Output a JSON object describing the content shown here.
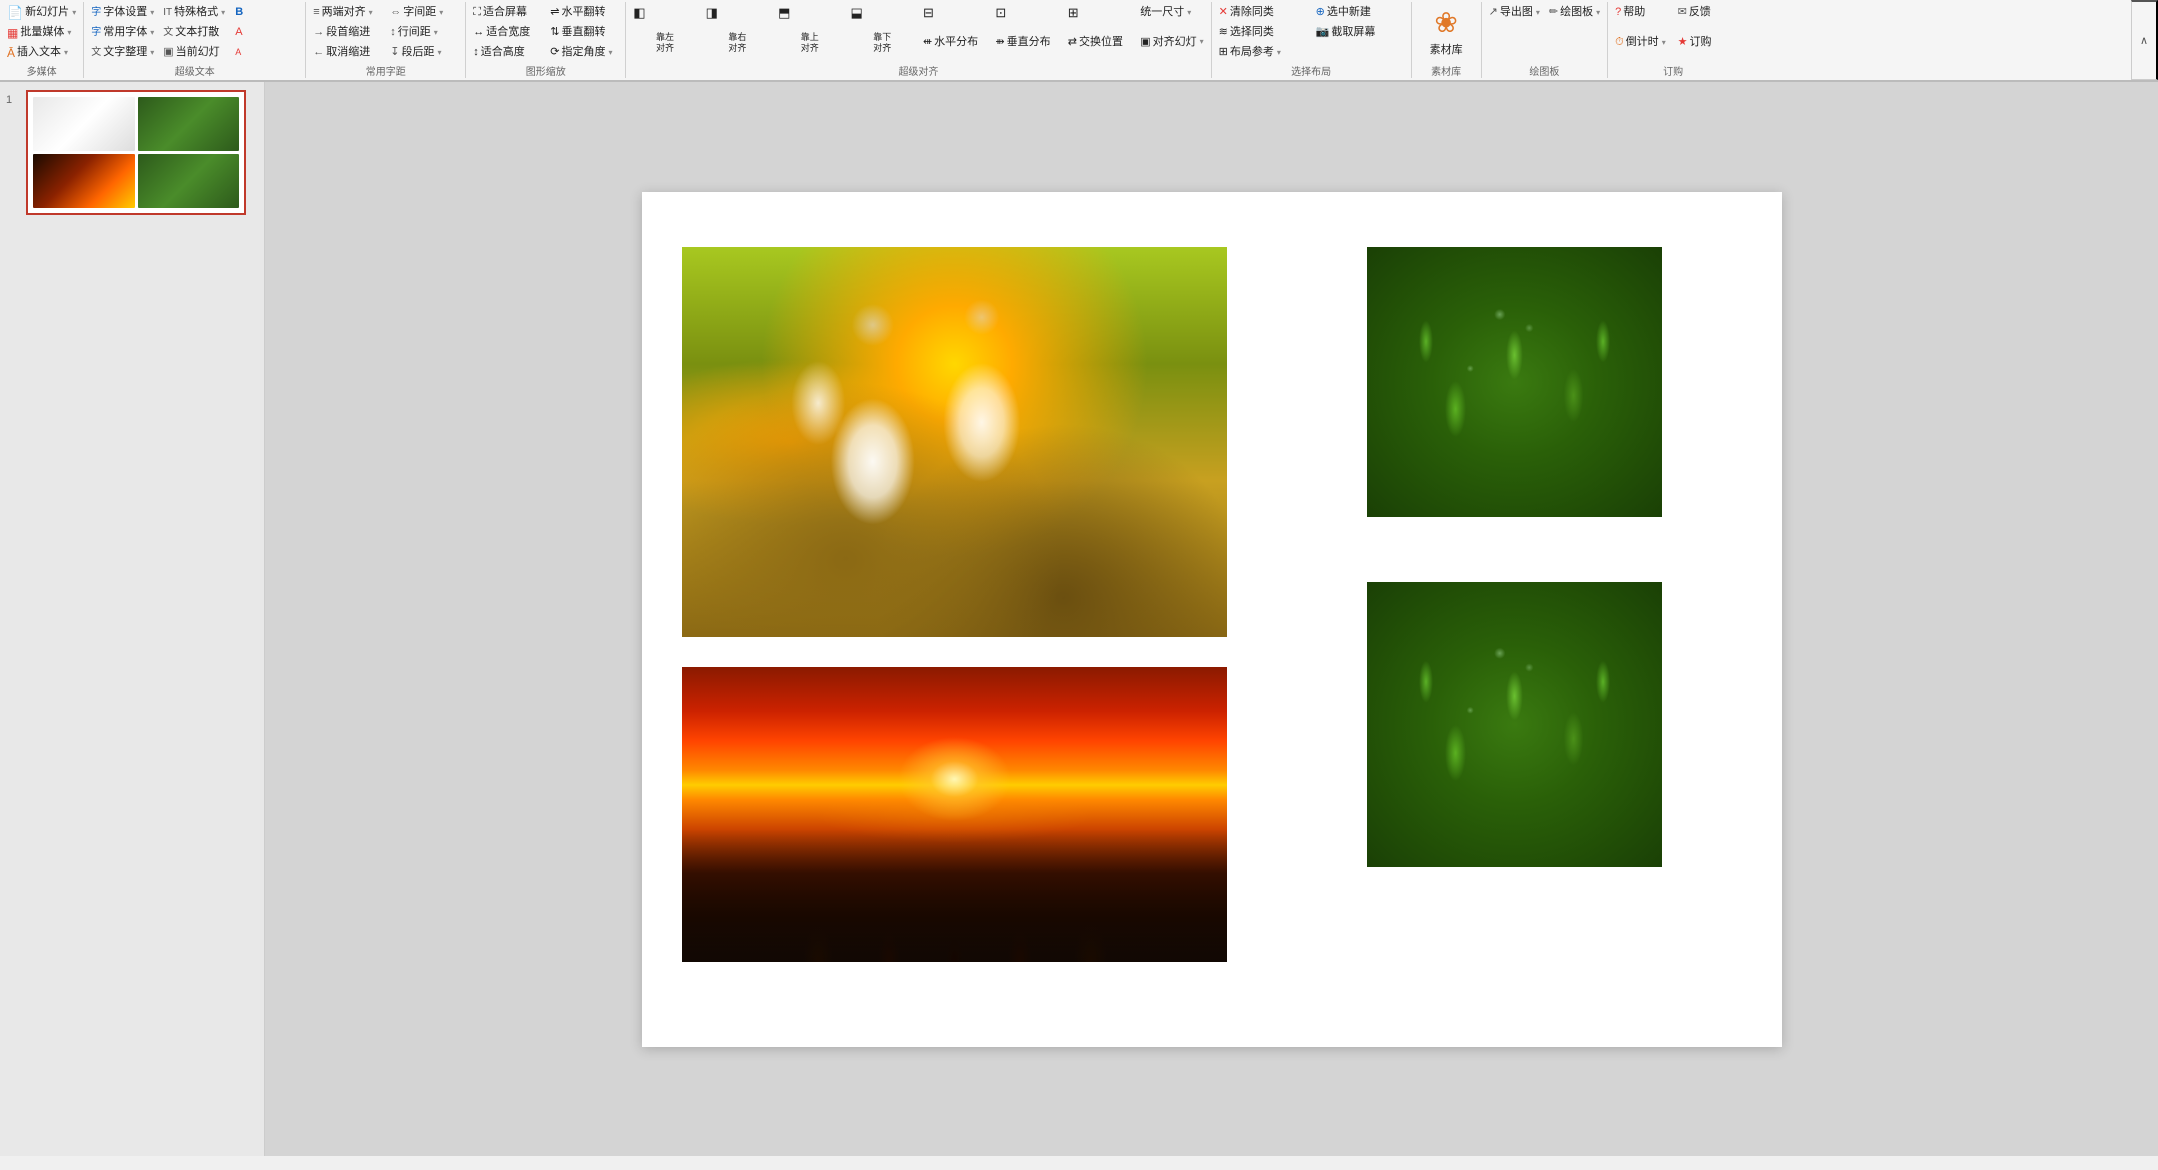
{
  "ribbon": {
    "sections": [
      {
        "id": "multimedia",
        "label": "多媒体",
        "rows": [
          [
            {
              "label": "新幻灯片",
              "icon": "📄",
              "arrow": true
            },
            {
              "label": "批量媒体",
              "icon": "▦",
              "arrow": true
            },
            {
              "label": "插入文本",
              "icon": "Ā",
              "arrow": true
            }
          ]
        ]
      },
      {
        "id": "supertext",
        "label": "超级文本",
        "rows": [
          [
            {
              "label": "字体设置",
              "icon": "字",
              "arrow": true
            },
            {
              "label": "常用字体",
              "icon": "字",
              "arrow": true
            },
            {
              "label": "文字整理",
              "icon": "字",
              "arrow": true
            }
          ],
          [
            {
              "label": "特殊格式",
              "icon": "IT",
              "arrow": true
            },
            {
              "label": "文本打散",
              "icon": "文",
              "arrow": false
            },
            {
              "label": "当前幻灯",
              "icon": "▣",
              "arrow": false
            }
          ]
        ]
      },
      {
        "id": "spacing",
        "label": "常用字距",
        "rows": [
          [
            {
              "label": "两端对齐",
              "icon": "≡",
              "arrow": true
            },
            {
              "label": "段首缩进",
              "icon": "→",
              "arrow": false
            },
            {
              "label": "取消缩进",
              "icon": "←",
              "arrow": false
            }
          ],
          [
            {
              "label": "字间距",
              "icon": "⇔",
              "arrow": true
            },
            {
              "label": "行间距",
              "icon": "↕",
              "arrow": true
            },
            {
              "label": "段后距",
              "icon": "↧",
              "arrow": true
            }
          ]
        ]
      },
      {
        "id": "shape-scale",
        "label": "图形缩放",
        "rows": [
          [
            {
              "label": "适合屏幕",
              "icon": "⛶",
              "arrow": false
            },
            {
              "label": "适合宽度",
              "icon": "↔",
              "arrow": false
            },
            {
              "label": "适合高度",
              "icon": "↕",
              "arrow": false
            }
          ],
          [
            {
              "label": "水平翻转",
              "icon": "⇌",
              "arrow": false
            },
            {
              "label": "垂直翻转",
              "icon": "⇅",
              "arrow": false
            },
            {
              "label": "指定角度",
              "icon": "⟳",
              "arrow": true
            }
          ]
        ]
      },
      {
        "id": "super-align",
        "label": "超级对齐",
        "rows": [
          [
            {
              "label": "靠左对齐",
              "icon": "◧",
              "arrow": false
            },
            {
              "label": "靠右对齐",
              "icon": "◨",
              "arrow": false
            },
            {
              "label": "靠上对齐",
              "icon": "⬒",
              "arrow": false
            },
            {
              "label": "靠下对齐",
              "icon": "⬓",
              "arrow": false
            },
            {
              "label": "水平居中",
              "icon": "⬛",
              "arrow": false
            },
            {
              "label": "绝对居中",
              "icon": "⊡",
              "arrow": false
            },
            {
              "label": "垂直居中",
              "icon": "⊟",
              "arrow": false
            },
            {
              "label": "统一尺寸",
              "icon": "⊞",
              "arrow": true
            }
          ],
          [
            {
              "label": "水平分布",
              "icon": "⇺",
              "arrow": false
            },
            {
              "label": "垂直分布",
              "icon": "⇻",
              "arrow": false
            },
            {
              "label": "交换位置",
              "icon": "⇄",
              "arrow": false
            },
            {
              "label": "对齐幻灯",
              "icon": "▣",
              "arrow": true
            }
          ]
        ]
      },
      {
        "id": "select-layout",
        "label": "选择布局",
        "rows": [
          [
            {
              "label": "清除同类",
              "icon": "✕",
              "arrow": false
            },
            {
              "label": "选中新建",
              "icon": "⊕",
              "arrow": false
            },
            {
              "label": "选择同类",
              "icon": "≋",
              "arrow": false
            },
            {
              "label": "截取屏幕",
              "icon": "📷",
              "arrow": false
            },
            {
              "label": "布局参考",
              "icon": "⊞",
              "arrow": true
            }
          ]
        ]
      },
      {
        "id": "material",
        "label": "素材库",
        "rows": [
          [
            {
              "label": "素材库",
              "icon": "❀",
              "arrow": false
            }
          ]
        ]
      },
      {
        "id": "drawing",
        "label": "绘图板",
        "rows": [
          [
            {
              "label": "导出图",
              "icon": "↗",
              "arrow": true
            },
            {
              "label": "绘图板",
              "icon": "✏",
              "arrow": true
            }
          ]
        ]
      },
      {
        "id": "order",
        "label": "订购",
        "rows": [
          [
            {
              "label": "帮助",
              "icon": "?",
              "arrow": false
            },
            {
              "label": "反馈",
              "icon": "✉",
              "arrow": false
            },
            {
              "label": "倒计时",
              "icon": "⏱",
              "arrow": true
            },
            {
              "label": "订购",
              "icon": "★",
              "arrow": false
            }
          ]
        ]
      }
    ],
    "collapse_label": "∧"
  },
  "slide_panel": {
    "slide_number": "1"
  },
  "canvas": {
    "images": [
      {
        "id": "flowers",
        "alt": "White flowers with dew drops"
      },
      {
        "id": "leaves-top",
        "alt": "Green leaves close-up top"
      },
      {
        "id": "sunset",
        "alt": "Coastal sunset with rock formations"
      },
      {
        "id": "leaves-bottom",
        "alt": "Green leaves close-up bottom"
      }
    ]
  }
}
